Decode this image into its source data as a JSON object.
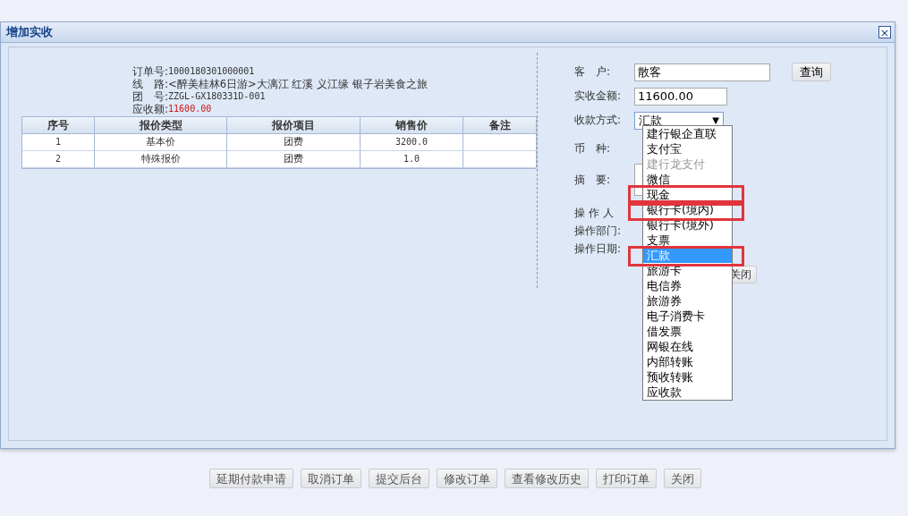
{
  "dialog": {
    "title": "增加实收",
    "close": "×",
    "order_info": [
      {
        "label": "订单号:",
        "value": "1000180301000001",
        "kind": "plain"
      },
      {
        "label": "线　路:",
        "value": "<醉美桂林6日游>大漓江 红溪 义江缘 银子岩美食之旅",
        "kind": "plain"
      },
      {
        "label": "团　号:",
        "value": "ZZGL-GX180331D-001",
        "kind": "plain"
      },
      {
        "label": "应收额:",
        "value": "11600.00",
        "kind": "amount"
      }
    ],
    "table": {
      "columns": [
        "序号",
        "报价类型",
        "报价项目",
        "销售价",
        "备注"
      ],
      "rows": [
        [
          "1",
          "基本价",
          "团费",
          "3200.0",
          ""
        ],
        [
          "2",
          "特殊报价",
          "团费",
          "1.0",
          ""
        ]
      ]
    },
    "form": {
      "customer": {
        "label": "客　户:",
        "value": "散客",
        "button": "查询"
      },
      "amount": {
        "label": "实收金额:",
        "value": "11600.00"
      },
      "method": {
        "label": "收款方式:",
        "value": "汇款",
        "arrow": "▼"
      },
      "labels": [
        "币　种:",
        "摘　要:",
        "操 作 人",
        "操作部门:",
        "操作日期:"
      ],
      "close_button": "关闭",
      "options": [
        {
          "label": "建行银企直联",
          "selected": false,
          "disabled": false,
          "highlighted": false
        },
        {
          "label": "支付宝",
          "selected": false,
          "disabled": false,
          "highlighted": false
        },
        {
          "label": "建行龙支付",
          "selected": false,
          "disabled": true,
          "highlighted": false
        },
        {
          "label": "微信",
          "selected": false,
          "disabled": false,
          "highlighted": false
        },
        {
          "label": "现金",
          "selected": false,
          "disabled": false,
          "highlighted": true
        },
        {
          "label": "银行卡(境内)",
          "selected": false,
          "disabled": false,
          "highlighted": true
        },
        {
          "label": "银行卡(境外)",
          "selected": false,
          "disabled": false,
          "highlighted": false
        },
        {
          "label": "支票",
          "selected": false,
          "disabled": false,
          "highlighted": false
        },
        {
          "label": "汇款",
          "selected": true,
          "disabled": false,
          "highlighted": true
        },
        {
          "label": "旅游卡",
          "selected": false,
          "disabled": false,
          "highlighted": false
        },
        {
          "label": "电信券",
          "selected": false,
          "disabled": false,
          "highlighted": false
        },
        {
          "label": "旅游券",
          "selected": false,
          "disabled": false,
          "highlighted": false
        },
        {
          "label": "电子消费卡",
          "selected": false,
          "disabled": false,
          "highlighted": false
        },
        {
          "label": "借发票",
          "selected": false,
          "disabled": false,
          "highlighted": false
        },
        {
          "label": "网银在线",
          "selected": false,
          "disabled": false,
          "highlighted": false
        },
        {
          "label": "内部转账",
          "selected": false,
          "disabled": false,
          "highlighted": false
        },
        {
          "label": "预收转账",
          "selected": false,
          "disabled": false,
          "highlighted": false
        },
        {
          "label": "应收款",
          "selected": false,
          "disabled": false,
          "highlighted": false
        }
      ]
    }
  },
  "buttons": [
    "延期付款申请",
    "取消订单",
    "提交后台",
    "修改订单",
    "查看修改历史",
    "打印订单",
    "关闭"
  ]
}
